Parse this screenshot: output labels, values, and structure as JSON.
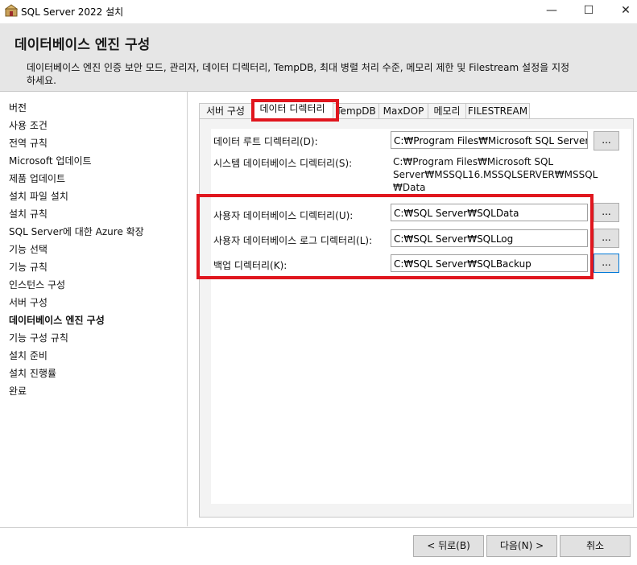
{
  "window": {
    "title": "SQL Server 2022 설치",
    "controls": {
      "minimize": "—",
      "maximize": "☐",
      "close": "✕"
    }
  },
  "header": {
    "title": "데이터베이스 엔진 구성",
    "description": "데이터베이스 엔진 인증 보안 모드, 관리자, 데이터 디렉터리, TempDB, 최대 병렬 처리 수준, 메모리 제한 및 Filestream 설정을 지정하세요."
  },
  "sidebar": {
    "items": [
      {
        "label": "버전"
      },
      {
        "label": "사용 조건"
      },
      {
        "label": "전역 규칙"
      },
      {
        "label": "Microsoft 업데이트"
      },
      {
        "label": "제품 업데이트"
      },
      {
        "label": "설치 파일 설치"
      },
      {
        "label": "설치 규칙"
      },
      {
        "label": "SQL Server에 대한 Azure 확장"
      },
      {
        "label": "기능 선택"
      },
      {
        "label": "기능 규칙"
      },
      {
        "label": "인스턴스 구성"
      },
      {
        "label": "서버 구성"
      },
      {
        "label": "데이터베이스 엔진 구성",
        "active": true
      },
      {
        "label": "기능 구성 규칙"
      },
      {
        "label": "설치 준비"
      },
      {
        "label": "설치 진행률"
      },
      {
        "label": "완료"
      }
    ]
  },
  "tabs": [
    {
      "label": "서버 구성"
    },
    {
      "label": "데이터 디렉터리",
      "selected": true
    },
    {
      "label": "TempDB"
    },
    {
      "label": "MaxDOP"
    },
    {
      "label": "메모리"
    },
    {
      "label": "FILESTREAM"
    }
  ],
  "fields": {
    "data_root": {
      "label": "데이터 루트 디렉터리(D):",
      "value": "C:₩Program Files₩Microsoft SQL Server₩"
    },
    "system_db": {
      "label": "시스템 데이터베이스 디렉터리(S):",
      "value": "C:₩Program Files₩Microsoft SQL Server₩MSSQL16.MSSQLSERVER₩MSSQL ₩Data"
    },
    "user_db": {
      "label": "사용자 데이터베이스 디렉터리(U):",
      "value": "C:₩SQL Server₩SQLData"
    },
    "user_log": {
      "label": "사용자 데이터베이스 로그 디렉터리(L):",
      "value": "C:₩SQL Server₩SQLLog"
    },
    "backup": {
      "label": "백업 디렉터리(K):",
      "value": "C:₩SQL Server₩SQLBackup"
    }
  },
  "browse_label": "...",
  "footer": {
    "back": "< 뒤로(B)",
    "next": "다음(N) >",
    "cancel": "취소"
  },
  "colors": {
    "highlight": "#e0161e",
    "header_bg": "#e6e6e6",
    "focus": "#0078d7"
  }
}
